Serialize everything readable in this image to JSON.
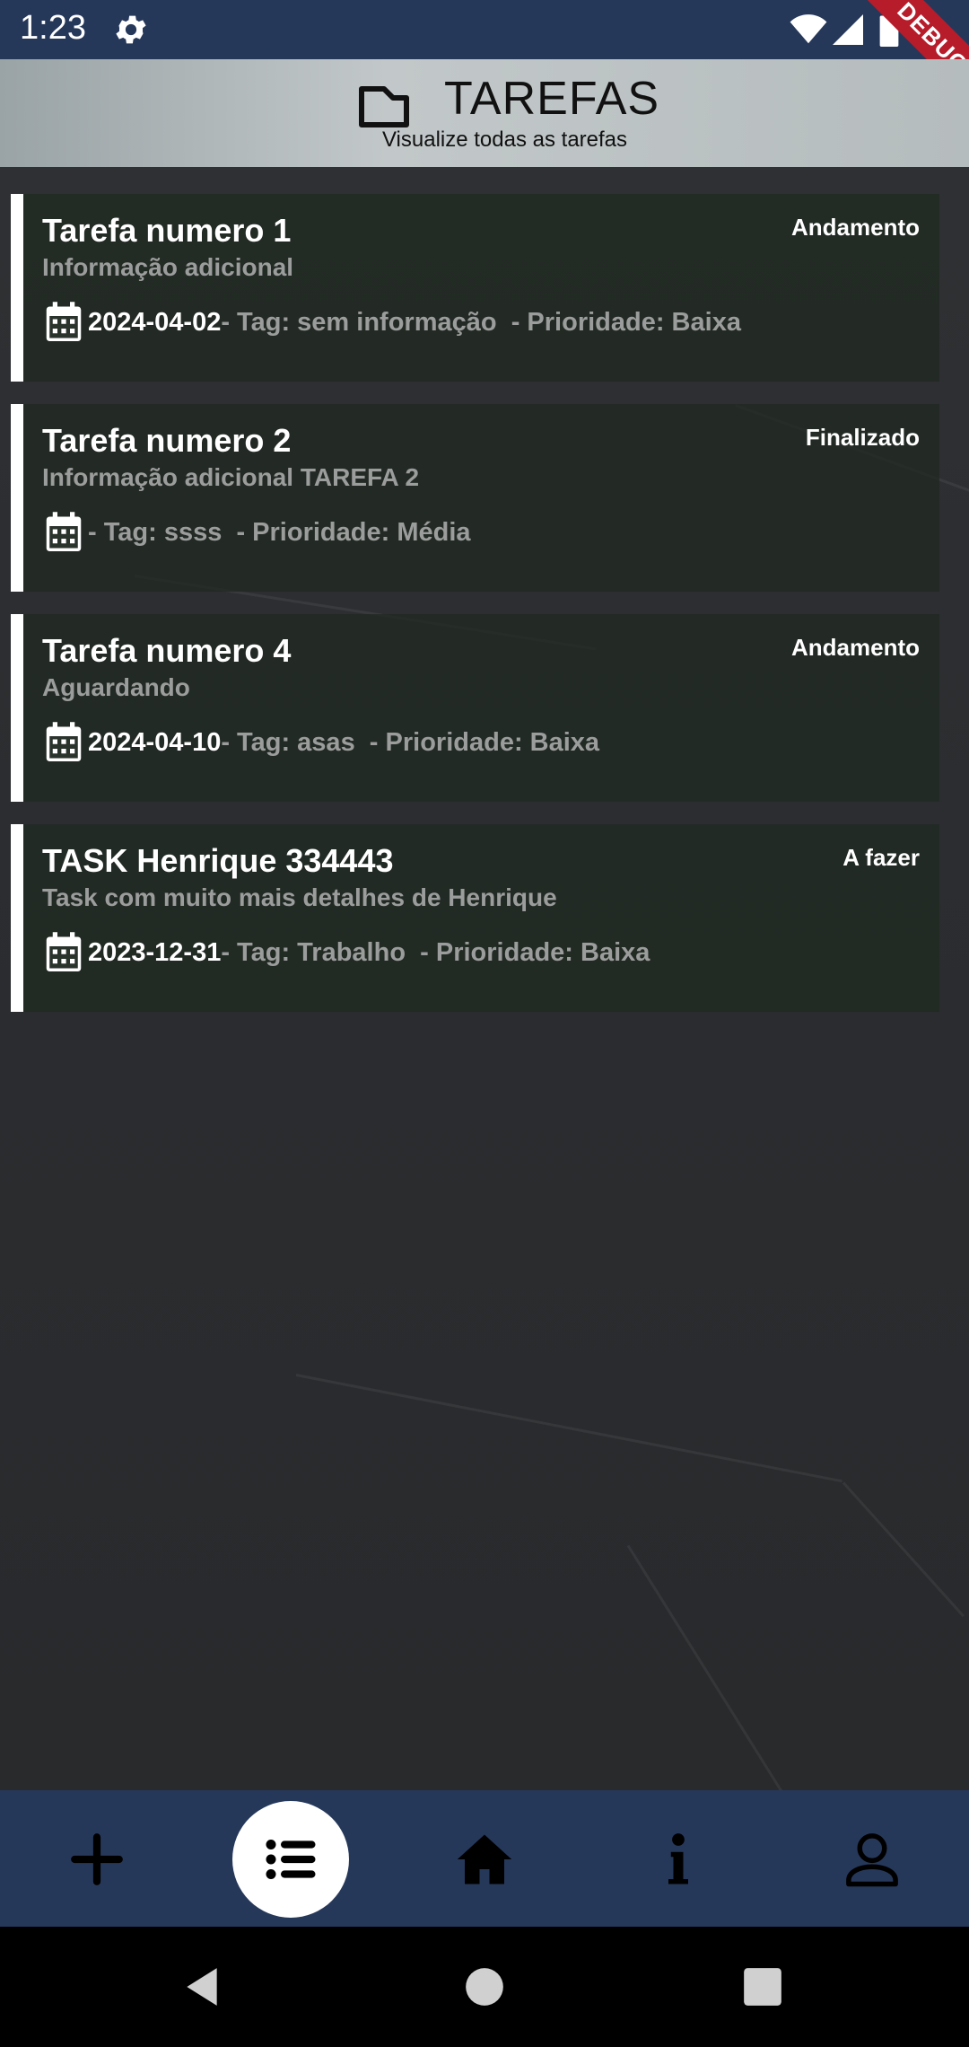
{
  "status_bar": {
    "time": "1:23",
    "icons": [
      "gear-icon",
      "wifi-icon",
      "signal-icon",
      "battery-icon"
    ],
    "debug_label": "DEBUG"
  },
  "header": {
    "icon": "folder-icon",
    "title": "TAREFAS",
    "subtitle": "Visualize todas as tarefas"
  },
  "tasks": [
    {
      "title": "Tarefa numero 1",
      "description": "Informação adicional",
      "status": "Andamento",
      "date": "2024-04-02",
      "info": "- Tag: sem informação  - Prioridade: Baixa"
    },
    {
      "title": "Tarefa numero 2",
      "description": "Informação adicional TAREFA 2",
      "status": "Finalizado",
      "date": "",
      "info": "- Tag: ssss  - Prioridade: Média"
    },
    {
      "title": "Tarefa numero 4",
      "description": "Aguardando",
      "status": "Andamento",
      "date": "2024-04-10",
      "info": "- Tag: asas  - Prioridade: Baixa"
    },
    {
      "title": "TASK Henrique 334443",
      "description": "Task com muito mais detalhes de Henrique",
      "status": "A fazer",
      "date": "2023-12-31",
      "info": "- Tag: Trabalho  - Prioridade: Baixa"
    }
  ],
  "bottom_nav": {
    "items": [
      "plus-icon",
      "list-icon",
      "home-icon",
      "info-icon",
      "person-icon"
    ],
    "active": "list-icon"
  },
  "colors": {
    "status_bar": "#26385a",
    "nav_bar": "#26385a",
    "card_bg": "#202a22",
    "accent_bar": "#ffffff",
    "muted_text": "#9b9d9c"
  }
}
